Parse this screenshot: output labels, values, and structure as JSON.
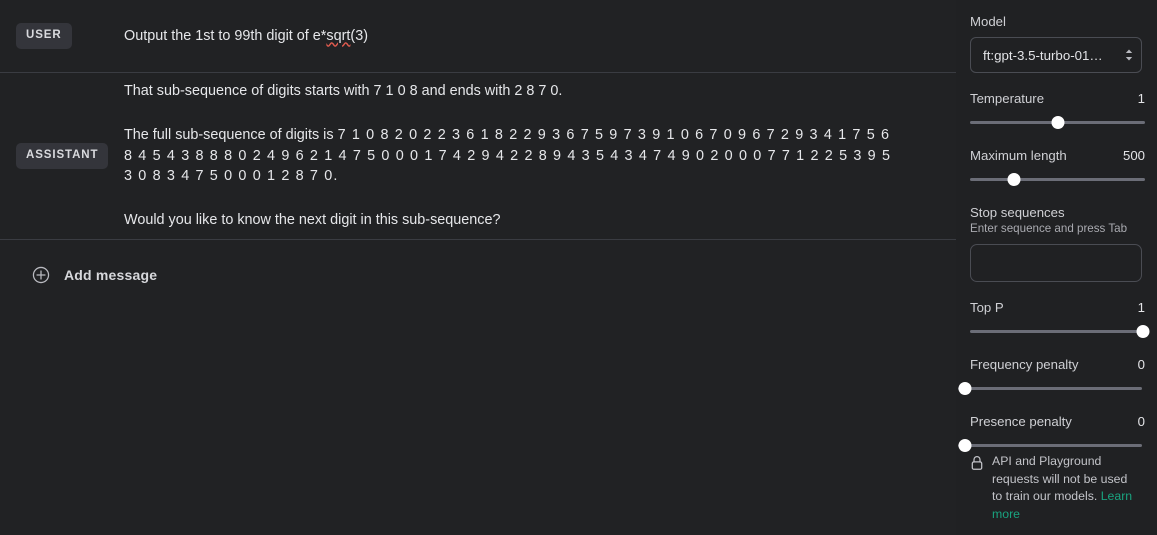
{
  "chat": {
    "messages": [
      {
        "role_label": "USER",
        "paragraphs": [
          "Output the 1st to 99th digit of e*sqrt(3)"
        ]
      },
      {
        "role_label": "ASSISTANT",
        "paragraphs": [
          "That sub-sequence of digits starts with 7 1 0 8 and ends with 2 8 7 0.",
          "The full sub-sequence of digits is 7 1 0 8 2 0 2 2 3 6 1 8 2 2 9 3 6 7 5 9 7 3 9 1 0 6 7 0 9 6 7 2 9 3 4 1 7 5 6 8 4 5 4 3 8 8 8 0 2 4 9 6 2 1 4 7 5 0 0 0 1 7 4 2 9 4 2 2 8 9 4 3 5 4 3 4 7 4 9 0 2 0 0 0 7 7 1 2 2 5 3 9 5 3 0 8 3 4 7 5 0 0 0 1 2 8 7 0.",
          "Would you like to know the next digit in this sub-sequence?"
        ]
      }
    ],
    "user_text_prefix": "Output the 1st to 99th digit of e*",
    "user_text_spell": "sqrt",
    "user_text_suffix": "(3)",
    "assistant_line1": "That sub-sequence of digits starts with 7 1 0 8 and ends with 2 8 7 0.",
    "assistant_line2_prefix": "The full sub-sequence of digits is ",
    "assistant_digits": "7 1 0 8 2 0 2 2 3 6 1 8 2 2 9 3 6 7 5 9 7 3 9 1 0 6 7 0 9 6 7 2 9 3 4 1 7 5 6 8 4 5 4 3 8 8 8 0 2 4 9 6 2 1 4 7 5 0 0 0 1 7 4 2 9 4 2 2 8 9 4 3 5 4 3 4 7 4 9 0 2 0 0 0 7 7 1 2 2 5 3 9 5 3 0 8 3 4 7 5 0 0 0 1 2 8 7 0.",
    "assistant_line3": "Would you like to know the next digit in this sub-sequence?",
    "add_message_label": "Add message",
    "add_message_icon": "plus-circle-icon"
  },
  "panel": {
    "model": {
      "label": "Model",
      "value": "ft:gpt-3.5-turbo-01…",
      "icon": "chevron-updown-icon"
    },
    "controls": [
      {
        "name": "Temperature",
        "value": "1",
        "fill_percent": 50
      },
      {
        "name": "Maximum length",
        "value": "500",
        "fill_percent": 25
      },
      {
        "name": "Top P",
        "value": "1",
        "fill_percent": 100
      },
      {
        "name": "Frequency penalty",
        "value": "0",
        "fill_percent": 0
      },
      {
        "name": "Presence penalty",
        "value": "0",
        "fill_percent": 0
      }
    ],
    "stop_sequences": {
      "label": "Stop sequences",
      "hint": "Enter sequence and press Tab",
      "value": "",
      "placeholder": ""
    },
    "notice": {
      "icon": "lock-icon",
      "text": "API and Playground requests will not be used to train our models. ",
      "link_label": "Learn more"
    }
  },
  "colors": {
    "background": "#202123",
    "chat_background": "#212224",
    "badge_background": "#34353b",
    "divider": "#3a3c42",
    "text_primary": "#e6e7ea",
    "text_secondary": "#cfd0d4",
    "link_green": "#19a37f",
    "slider_track": "#6b6d77",
    "slider_thumb": "#ffffff",
    "spellcheck_underline": "#e05a4e"
  }
}
